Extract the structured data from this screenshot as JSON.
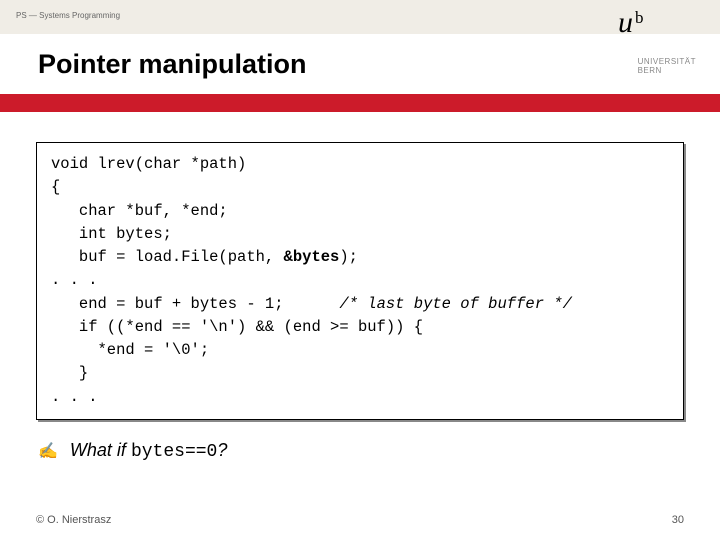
{
  "header": {
    "course": "PS — Systems Programming",
    "title": "Pointer manipulation",
    "logo_u": "u",
    "logo_b": "b",
    "uni_line1": "UNIVERSITÄT",
    "uni_line2": "BERN"
  },
  "code": {
    "l1a": "void lrev(char *path)",
    "l2": "{",
    "l3": "   char *buf, *end;",
    "l4": "   int bytes;",
    "l5a": "   buf = load.File(path, ",
    "l5b": "&bytes",
    "l5c": ");",
    "l6": ". . .",
    "l7a": "   end = buf + bytes - 1;      ",
    "l7b": "/* last byte of buffer */",
    "l8": "   if ((*end == '\\n') && (end >= buf)) {",
    "l9": "     *end = '\\0';",
    "l10": "   }",
    "l11": ". . ."
  },
  "question": {
    "prefix": "What if ",
    "mono": "bytes==0",
    "suffix": "?"
  },
  "footer": {
    "copyright": "© O. Nierstrasz",
    "page": "30"
  }
}
